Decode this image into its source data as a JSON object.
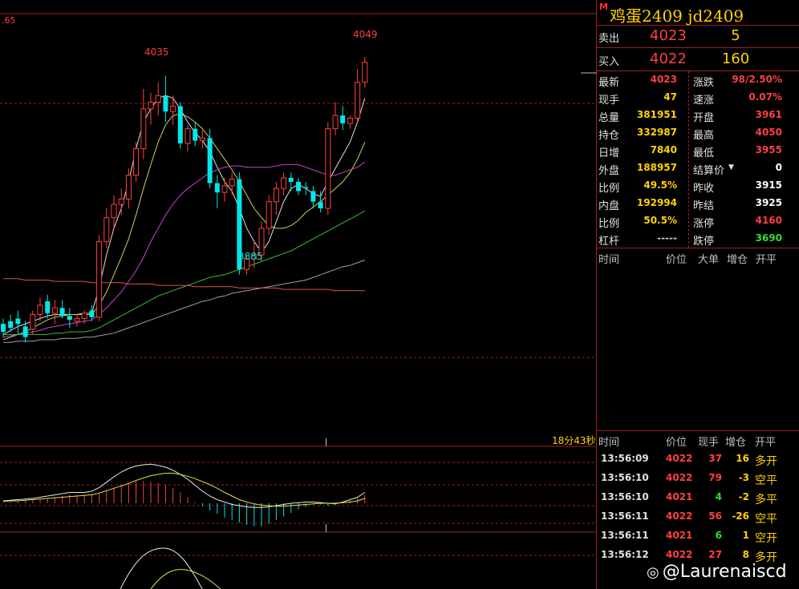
{
  "instrument": {
    "mark": "M",
    "title": "鸡蛋2409  jd2409"
  },
  "quote": {
    "ask": {
      "label": "卖出",
      "price": "4023",
      "volume": "5"
    },
    "bid": {
      "label": "买入",
      "price": "4022",
      "volume": "160"
    }
  },
  "stats": [
    {
      "l1": "最新",
      "v1": "4023",
      "c1": "#ff4040",
      "l2": "涨跌",
      "v2": "98/2.50%",
      "c2": "#ff4040"
    },
    {
      "l1": "现手",
      "v1": "47",
      "c1": "#ffd200",
      "l2": "速涨",
      "v2": "0.07%",
      "c2": "#ff4040"
    },
    {
      "l1": "总量",
      "v1": "381951",
      "c1": "#ffd200",
      "l2": "开盘",
      "v2": "3961",
      "c2": "#ff4040"
    },
    {
      "l1": "持仓",
      "v1": "332987",
      "c1": "#ffd200",
      "l2": "最高",
      "v2": "4050",
      "c2": "#ff4040"
    },
    {
      "l1": "日增",
      "v1": "7840",
      "c1": "#ffd200",
      "l2": "最低",
      "v2": "3955",
      "c2": "#ff4040"
    },
    {
      "l1": "外盘",
      "v1": "188957",
      "c1": "#ffd200",
      "l2": "结算价",
      "v2": "0",
      "c2": "#ffffff"
    },
    {
      "l1": "比例",
      "v1": "49.5%",
      "c1": "#ffd200",
      "l2": "昨收",
      "v2": "3915",
      "c2": "#ffffff"
    },
    {
      "l1": "内盘",
      "v1": "192994",
      "c1": "#ffd200",
      "l2": "昨结",
      "v2": "3925",
      "c2": "#ffffff"
    },
    {
      "l1": "比例",
      "v1": "50.5%",
      "c1": "#ffd200",
      "l2": "涨停",
      "v2": "4160",
      "c2": "#ff4040"
    },
    {
      "l1": "杠杆",
      "v1": "-----",
      "c1": "#c8c8c8",
      "l2": "跌停",
      "v2": "3690",
      "c2": "#30e030"
    }
  ],
  "table1_headers": [
    "时间",
    "价位",
    "大单",
    "增仓",
    "开平"
  ],
  "table2_headers": [
    "时间",
    "价位",
    "现手",
    "增仓",
    "开平"
  ],
  "ticks": [
    {
      "time": "13:56:09",
      "price": "4022",
      "vol": "37",
      "vcolor": "#ff4040",
      "chg": "16",
      "kind": "多开"
    },
    {
      "time": "13:56:10",
      "price": "4022",
      "vol": "79",
      "vcolor": "#ff4040",
      "chg": "-3",
      "kind": "空平"
    },
    {
      "time": "13:56:10",
      "price": "4021",
      "vol": "4",
      "vcolor": "#30e030",
      "chg": "-2",
      "kind": "多平"
    },
    {
      "time": "13:56:11",
      "price": "4022",
      "vol": "56",
      "vcolor": "#ff4040",
      "chg": "-26",
      "kind": "空平"
    },
    {
      "time": "13:56:11",
      "price": "4021",
      "vol": "6",
      "vcolor": "#30e030",
      "chg": "1",
      "kind": "空开"
    },
    {
      "time": "13:56:12",
      "price": "4022",
      "vol": "27",
      "vcolor": "#ff4040",
      "chg": "8",
      "kind": "多开"
    }
  ],
  "countdown": "18分43秒",
  "axis_label": ".65",
  "watermark": "@Laurenaiscd",
  "chart_data": {
    "type": "candlestick",
    "high_label": "4049",
    "peak_label": "4035",
    "low_label": "3885",
    "ylim": [
      3836,
      4063
    ],
    "candles": [
      {
        "o": 3848,
        "h": 3852,
        "l": 3838,
        "c": 3842
      },
      {
        "o": 3850,
        "h": 3855,
        "l": 3842,
        "c": 3845
      },
      {
        "o": 3852,
        "h": 3858,
        "l": 3840,
        "c": 3848
      },
      {
        "o": 3846,
        "h": 3850,
        "l": 3834,
        "c": 3838
      },
      {
        "o": 3844,
        "h": 3858,
        "l": 3840,
        "c": 3855
      },
      {
        "o": 3855,
        "h": 3868,
        "l": 3850,
        "c": 3862
      },
      {
        "o": 3865,
        "h": 3870,
        "l": 3852,
        "c": 3856
      },
      {
        "o": 3856,
        "h": 3866,
        "l": 3848,
        "c": 3860
      },
      {
        "o": 3860,
        "h": 3866,
        "l": 3852,
        "c": 3854
      },
      {
        "o": 3854,
        "h": 3860,
        "l": 3845,
        "c": 3851
      },
      {
        "o": 3850,
        "h": 3856,
        "l": 3846,
        "c": 3852
      },
      {
        "o": 3852,
        "h": 3858,
        "l": 3848,
        "c": 3856
      },
      {
        "o": 3858,
        "h": 3862,
        "l": 3850,
        "c": 3853
      },
      {
        "o": 3853,
        "h": 3915,
        "l": 3850,
        "c": 3910
      },
      {
        "o": 3910,
        "h": 3935,
        "l": 3905,
        "c": 3928
      },
      {
        "o": 3928,
        "h": 3945,
        "l": 3920,
        "c": 3938
      },
      {
        "o": 3938,
        "h": 3950,
        "l": 3930,
        "c": 3942
      },
      {
        "o": 3942,
        "h": 3965,
        "l": 3935,
        "c": 3960
      },
      {
        "o": 3960,
        "h": 3985,
        "l": 3955,
        "c": 3980
      },
      {
        "o": 3980,
        "h": 4025,
        "l": 3972,
        "c": 4010
      },
      {
        "o": 4010,
        "h": 4022,
        "l": 3998,
        "c": 4015
      },
      {
        "o": 4015,
        "h": 4030,
        "l": 4005,
        "c": 4020
      },
      {
        "o": 4020,
        "h": 4035,
        "l": 4000,
        "c": 4008
      },
      {
        "o": 4008,
        "h": 4020,
        "l": 3998,
        "c": 4012
      },
      {
        "o": 4012,
        "h": 4015,
        "l": 3980,
        "c": 3984
      },
      {
        "o": 3984,
        "h": 3998,
        "l": 3978,
        "c": 3995
      },
      {
        "o": 3995,
        "h": 4000,
        "l": 3982,
        "c": 3986
      },
      {
        "o": 3986,
        "h": 3994,
        "l": 3980,
        "c": 3988
      },
      {
        "o": 3988,
        "h": 3995,
        "l": 3950,
        "c": 3954
      },
      {
        "o": 3954,
        "h": 3960,
        "l": 3935,
        "c": 3947
      },
      {
        "o": 3947,
        "h": 3958,
        "l": 3940,
        "c": 3952
      },
      {
        "o": 3952,
        "h": 3962,
        "l": 3945,
        "c": 3957
      },
      {
        "o": 3957,
        "h": 3962,
        "l": 3885,
        "c": 3889
      },
      {
        "o": 3889,
        "h": 3900,
        "l": 3885,
        "c": 3897
      },
      {
        "o": 3897,
        "h": 3910,
        "l": 3890,
        "c": 3900
      },
      {
        "o": 3900,
        "h": 3925,
        "l": 3895,
        "c": 3920
      },
      {
        "o": 3920,
        "h": 3945,
        "l": 3915,
        "c": 3940
      },
      {
        "o": 3940,
        "h": 3955,
        "l": 3930,
        "c": 3950
      },
      {
        "o": 3950,
        "h": 3962,
        "l": 3945,
        "c": 3958
      },
      {
        "o": 3958,
        "h": 3962,
        "l": 3948,
        "c": 3955
      },
      {
        "o": 3955,
        "h": 3958,
        "l": 3945,
        "c": 3948
      },
      {
        "o": 3951,
        "h": 3955,
        "l": 3945,
        "c": 3950
      },
      {
        "o": 3948,
        "h": 3952,
        "l": 3935,
        "c": 3940
      },
      {
        "o": 3940,
        "h": 3948,
        "l": 3932,
        "c": 3935
      },
      {
        "o": 3935,
        "h": 4000,
        "l": 3930,
        "c": 3995
      },
      {
        "o": 3995,
        "h": 4015,
        "l": 3990,
        "c": 4005
      },
      {
        "o": 4005,
        "h": 4012,
        "l": 3994,
        "c": 3999
      },
      {
        "o": 3999,
        "h": 4005,
        "l": 3995,
        "c": 4003
      },
      {
        "o": 4003,
        "h": 4040,
        "l": 4000,
        "c": 4030
      },
      {
        "o": 4030,
        "h": 4049,
        "l": 4026,
        "c": 4045
      }
    ],
    "ma_lines": [
      {
        "color": "#e0e0e0",
        "values": [
          3840,
          3843,
          3846,
          3848,
          3850,
          3852,
          3854,
          3855,
          3855,
          3855,
          3855,
          3856,
          3856,
          3875,
          3900,
          3920,
          3935,
          3955,
          3980,
          4000,
          4010,
          4018,
          4020,
          4018,
          4010,
          4000,
          3992,
          3986,
          3978,
          3966,
          3955,
          3948,
          3935,
          3920,
          3910,
          3902,
          3910,
          3925,
          3940,
          3950,
          3953,
          3950,
          3946,
          3944,
          3955,
          3965,
          3975,
          3985,
          4000,
          4018
        ]
      },
      {
        "color": "#d0d060",
        "values": [
          3836,
          3838,
          3840,
          3842,
          3845,
          3848,
          3851,
          3853,
          3854,
          3855,
          3855,
          3855,
          3855,
          3862,
          3872,
          3885,
          3898,
          3912,
          3930,
          3950,
          3968,
          3985,
          3998,
          4005,
          4006,
          4004,
          4000,
          3995,
          3988,
          3980,
          3972,
          3964,
          3955,
          3945,
          3935,
          3928,
          3922,
          3920,
          3920,
          3922,
          3926,
          3932,
          3936,
          3940,
          3945,
          3950,
          3955,
          3962,
          3972,
          3985
        ]
      },
      {
        "color": "#d040d0",
        "values": [
          3838,
          3839,
          3840,
          3841,
          3842,
          3843,
          3845,
          3846,
          3847,
          3848,
          3849,
          3850,
          3851,
          3855,
          3860,
          3866,
          3872,
          3880,
          3888,
          3898,
          3910,
          3920,
          3930,
          3938,
          3945,
          3950,
          3954,
          3958,
          3962,
          3964,
          3966,
          3967,
          3967,
          3966,
          3966,
          3966,
          3966,
          3967,
          3968,
          3968,
          3968,
          3966,
          3964,
          3962,
          3960,
          3960,
          3962,
          3964,
          3966,
          3970
        ]
      },
      {
        "color": "#30c030",
        "values": [
          3840,
          3840,
          3840,
          3840,
          3840,
          3840,
          3840,
          3841,
          3841,
          3842,
          3842,
          3842,
          3843,
          3845,
          3848,
          3851,
          3854,
          3857,
          3860,
          3863,
          3866,
          3869,
          3871,
          3873,
          3875,
          3877,
          3879,
          3881,
          3883,
          3884,
          3885,
          3887,
          3889,
          3891,
          3893,
          3895,
          3897,
          3899,
          3901,
          3903,
          3906,
          3909,
          3912,
          3915,
          3918,
          3921,
          3924,
          3927,
          3930,
          3933
        ]
      },
      {
        "color": "#a0a0a0",
        "values": [
          3834,
          3834,
          3835,
          3835,
          3835,
          3836,
          3836,
          3836,
          3837,
          3837,
          3837,
          3838,
          3838,
          3839,
          3840,
          3841,
          3843,
          3845,
          3847,
          3849,
          3851,
          3853,
          3855,
          3857,
          3859,
          3861,
          3863,
          3865,
          3866,
          3868,
          3869,
          3871,
          3872,
          3873,
          3874,
          3875,
          3876,
          3877,
          3878,
          3879,
          3880,
          3881,
          3883,
          3885,
          3887,
          3889,
          3891,
          3892,
          3894,
          3896
        ]
      },
      {
        "color": "#e05050",
        "values": [
          3882,
          3882,
          3882,
          3881,
          3881,
          3881,
          3881,
          3880,
          3880,
          3880,
          3880,
          3880,
          3879,
          3879,
          3879,
          3879,
          3879,
          3878,
          3878,
          3878,
          3878,
          3877,
          3877,
          3877,
          3877,
          3877,
          3876,
          3876,
          3876,
          3876,
          3876,
          3876,
          3875,
          3875,
          3875,
          3875,
          3875,
          3875,
          3874,
          3874,
          3874,
          3874,
          3874,
          3874,
          3874,
          3873,
          3873,
          3873,
          3873,
          3873
        ]
      }
    ],
    "macd": [
      1,
      2,
      3,
      4,
      5,
      6,
      8,
      10,
      12,
      14,
      14,
      15,
      16,
      18,
      22,
      26,
      30,
      34,
      36,
      37,
      36,
      34,
      30,
      25,
      18,
      10,
      2,
      -5,
      -12,
      -18,
      -24,
      -28,
      -32,
      -36,
      -38,
      -38,
      -34,
      -28,
      -22,
      -16,
      -10,
      -6,
      -2,
      -2,
      -4,
      -3,
      2,
      5,
      8,
      14
    ],
    "dif": [
      4,
      5,
      6,
      7,
      8,
      10,
      12,
      14,
      16,
      18,
      18,
      18,
      20,
      26,
      35,
      44,
      52,
      58,
      62,
      64,
      65,
      63,
      60,
      55,
      48,
      40,
      30,
      20,
      12,
      6,
      2,
      -2,
      -4,
      -6,
      -7,
      -7,
      -6,
      -4,
      -2,
      0,
      1,
      2,
      2,
      1,
      0,
      -1,
      2,
      6,
      10,
      18
    ],
    "dea": [
      3,
      4,
      4,
      5,
      6,
      7,
      8,
      9,
      10,
      11,
      12,
      13,
      14,
      17,
      21,
      25,
      29,
      33,
      38,
      42,
      46,
      48,
      50,
      50,
      48,
      45,
      41,
      36,
      31,
      25,
      18,
      12,
      6,
      2,
      -1,
      -3,
      -4,
      -5,
      -5,
      -4,
      -3,
      -2,
      -1,
      0,
      0,
      0,
      1,
      2,
      4,
      8
    ],
    "kd_k": [
      0,
      0,
      0,
      0,
      0,
      0,
      0,
      0,
      0,
      0,
      0,
      0,
      0,
      0,
      0,
      0,
      0,
      0,
      0,
      0,
      0,
      0,
      0,
      0,
      0,
      0,
      0,
      0,
      0,
      0,
      0,
      0,
      0,
      0,
      0,
      0,
      0,
      0,
      0,
      0,
      0,
      0,
      0,
      0,
      0,
      0,
      0,
      0,
      0,
      0
    ]
  }
}
